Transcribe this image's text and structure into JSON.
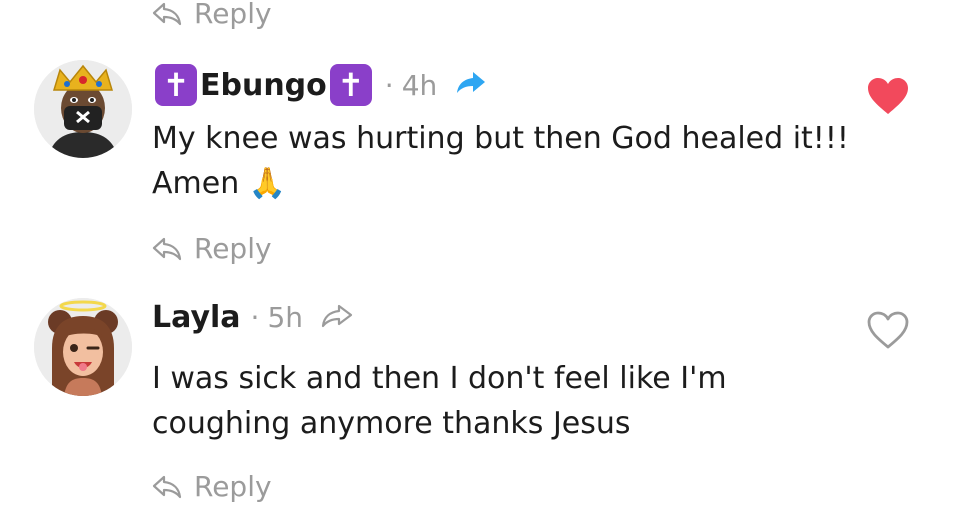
{
  "top_reply": {
    "label": "Reply",
    "icon": "reply-arrow-icon"
  },
  "comments": [
    {
      "username": "Ebungo",
      "badge_glyph": "✝",
      "badge_color": "#8a3fc9",
      "dot": "·",
      "time": "4h",
      "share_icon": "share-arrow-filled-icon",
      "share_color": "#2ea6f2",
      "text": "My knee was hurting but then God healed it!!! Amen",
      "emoji": "🙏",
      "liked": true,
      "heart_icon": "heart-filled-icon",
      "heart_color": "#f2495c",
      "reply_label": "Reply"
    },
    {
      "username": "Layla",
      "dot": "·",
      "time": "5h",
      "share_icon": "share-arrow-outline-icon",
      "text": "I was sick and then I don't feel like I'm coughing anymore thanks Jesus",
      "liked": false,
      "heart_icon": "heart-outline-icon",
      "reply_label": "Reply"
    }
  ]
}
